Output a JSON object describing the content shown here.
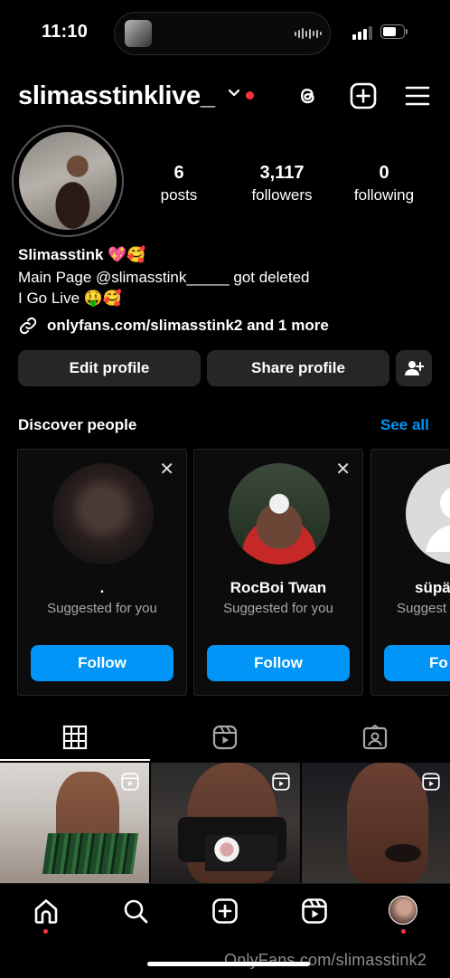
{
  "status_bar": {
    "time": "11:10"
  },
  "header": {
    "username": "slimasstink live_",
    "username_display": "slimasstinklive_"
  },
  "profile": {
    "stats": [
      {
        "value": "6",
        "label": "posts"
      },
      {
        "value": "3,117",
        "label": "followers"
      },
      {
        "value": "0",
        "label": "following"
      }
    ],
    "name": "Slimasstink 💖🥰",
    "bio_lines": [
      "Main Page @slimasstink_____ got deleted",
      "I Go Live 🤑🥰"
    ],
    "link_text": "onlyfans.com/slimasstink2 and 1 more"
  },
  "actions": {
    "edit_profile": "Edit profile",
    "share_profile": "Share profile"
  },
  "discover": {
    "title": "Discover people",
    "see_all": "See all",
    "cards": [
      {
        "name": ".",
        "subtitle": "Suggested for you",
        "button": "Follow"
      },
      {
        "name": "RocBoi Twan",
        "subtitle": "Suggested for you",
        "button": "Follow"
      },
      {
        "name": "süpä",
        "subtitle": "Suggest",
        "button": "Fo"
      }
    ]
  },
  "watermark": "OnlyFans.com/slimasstink2",
  "colors": {
    "accent": "#0095f6",
    "notification": "#ff3040",
    "button_bg": "#262626"
  }
}
